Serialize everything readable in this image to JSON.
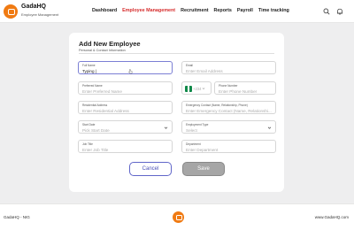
{
  "header": {
    "brand": "GadaHQ",
    "brand_sub": "Employee Management",
    "nav": [
      "Dashboard",
      "Employee Management",
      "Recruitment",
      "Reports",
      "Payroll",
      "Time tracking"
    ],
    "active_nav": "Employee Management",
    "icons": [
      "search-icon",
      "bell-icon"
    ]
  },
  "form": {
    "title": "Add New Employee",
    "subtitle": "Personal & Contact Information",
    "fields": {
      "full_name": {
        "label": "Full Name",
        "value": "Typing |"
      },
      "email": {
        "label": "Email",
        "placeholder": "Enter Email Address"
      },
      "preferred_name": {
        "label": "Preferred Name",
        "placeholder": "Enter Preferred Name"
      },
      "phone": {
        "label": "Phone Number",
        "placeholder": "Enter Phone Number",
        "country_code": "+234"
      },
      "residential_address": {
        "label": "Residential Address",
        "placeholder": "Enter Residential Address"
      },
      "emergency_contact": {
        "label": "Emergency Contact (Name, Relationship, Phone)",
        "placeholder": "Enter Emergency Contact (Name, Relationshi..."
      },
      "start_date": {
        "label": "Start Date",
        "placeholder": "Pick Start Date"
      },
      "employment_type": {
        "label": "Employment Type",
        "placeholder": "Select"
      },
      "job_title": {
        "label": "Job Title",
        "placeholder": "Enter Job Title"
      },
      "department": {
        "label": "Department",
        "placeholder": "Enter Department"
      }
    },
    "cancel_label": "Cancel",
    "save_label": "Save"
  },
  "footer": {
    "left": "GadaHQ - NIG",
    "right": "www.GadaHQ.com"
  },
  "colors": {
    "accent": "#d62d2d",
    "brand": "#f07a12",
    "focus": "#7b7fd4",
    "button_primary": "#4a4fb8",
    "button_disabled": "#a6a6a6"
  }
}
